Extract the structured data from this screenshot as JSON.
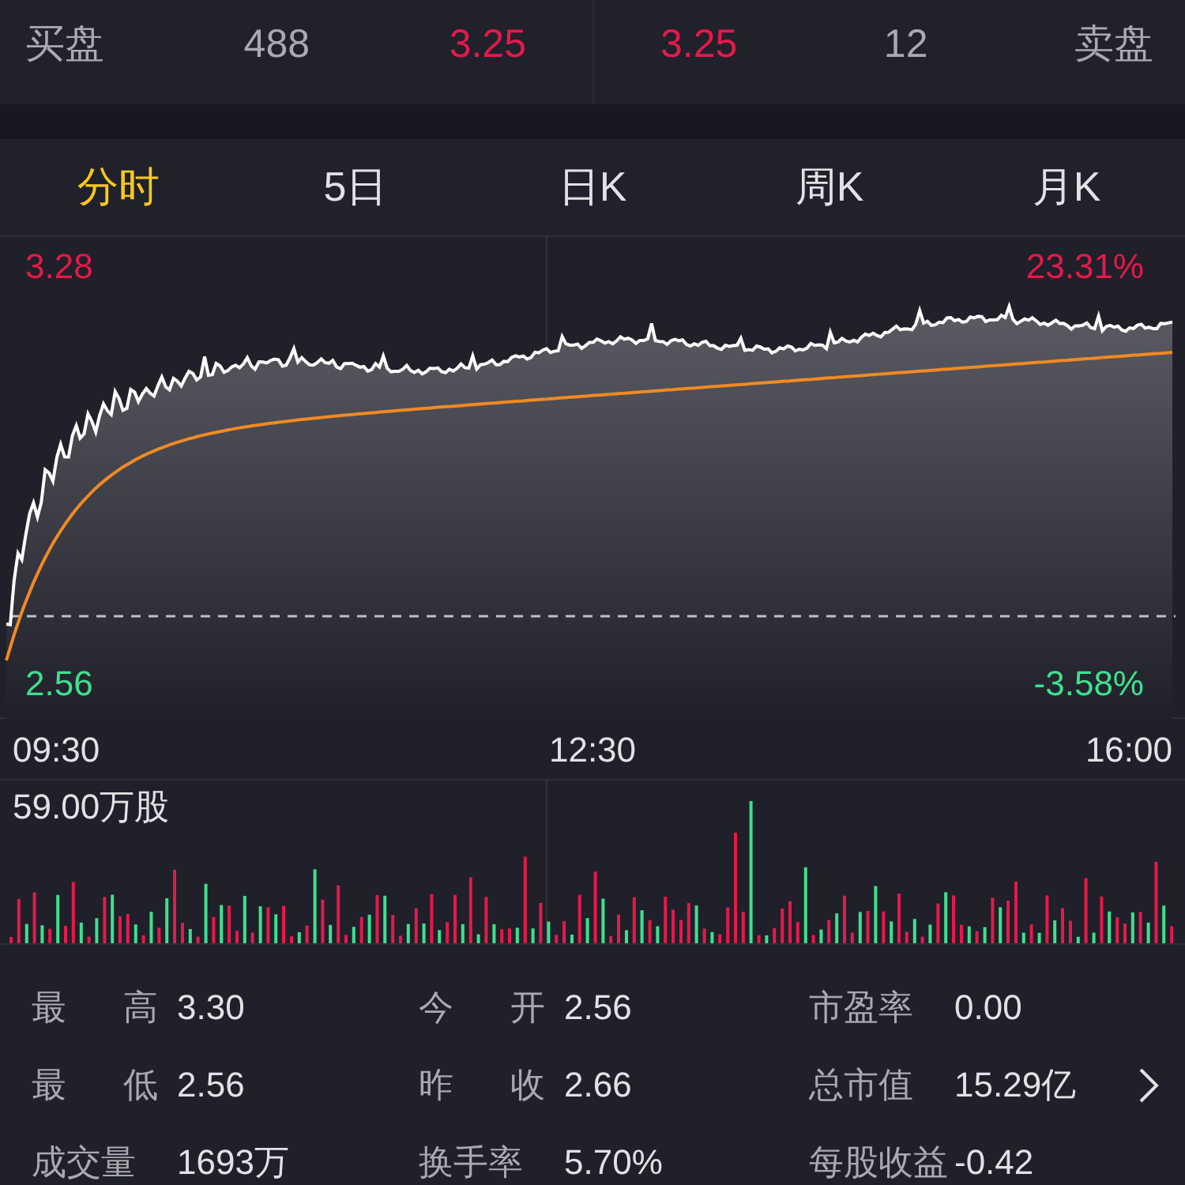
{
  "order_book": {
    "bid": {
      "label": "买盘",
      "volume": "488",
      "price": "3.25"
    },
    "ask": {
      "price": "3.25",
      "volume": "12",
      "label": "卖盘"
    }
  },
  "tabs": [
    {
      "label": "分时",
      "selected": true
    },
    {
      "label": "5日",
      "selected": false
    },
    {
      "label": "日K",
      "selected": false
    },
    {
      "label": "周K",
      "selected": false
    },
    {
      "label": "月K",
      "selected": false
    }
  ],
  "chart": {
    "high_price": "3.28",
    "high_change": "23.31%",
    "low_price": "2.56",
    "low_change": "-3.58%",
    "times": [
      "09:30",
      "12:30",
      "16:00"
    ]
  },
  "volume": {
    "max_label": "59.00万股"
  },
  "stats": [
    [
      {
        "label": "最高",
        "value": "3.30",
        "spread": true
      },
      {
        "label": "今开",
        "value": "2.56",
        "spread": true
      },
      {
        "label": "市盈率",
        "value": "0.00",
        "spread": false
      }
    ],
    [
      {
        "label": "最低",
        "value": "2.56",
        "spread": true
      },
      {
        "label": "昨收",
        "value": "2.66",
        "spread": true
      },
      {
        "label": "总市值",
        "value": "15.29亿",
        "spread": false
      }
    ],
    [
      {
        "label": "成交量",
        "value": "1693万",
        "spread": false
      },
      {
        "label": "换手率",
        "value": "5.70%",
        "spread": false
      },
      {
        "label": "每股收益",
        "value": "-0.42",
        "spread": false
      }
    ]
  ]
}
